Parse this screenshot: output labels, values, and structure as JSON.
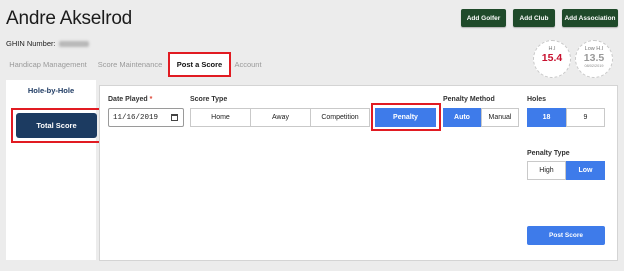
{
  "header": {
    "title": "Andre Akselrod",
    "ghin_label": "GHIN Number:",
    "buttons": {
      "add_golfer": "Add Golfer",
      "add_club": "Add Club",
      "add_association": "Add Association"
    }
  },
  "tabs": [
    {
      "label": "Handicap Management"
    },
    {
      "label": "Score Maintenance"
    },
    {
      "label": "Post a Score"
    },
    {
      "label": "Account"
    }
  ],
  "badges": {
    "hi": {
      "label": "H.I",
      "value": "15.4"
    },
    "low_hi": {
      "label": "Low H.I",
      "value": "13.5",
      "date": "08/02/2019"
    }
  },
  "sidebar": {
    "hole_by_hole": "Hole-by-Hole",
    "total_score": "Total Score"
  },
  "form": {
    "date_played": {
      "label": "Date Played",
      "required_mark": "*",
      "value": "11/16/2019"
    },
    "score_type": {
      "label": "Score Type",
      "options": [
        "Home",
        "Away",
        "Competition",
        "Penalty"
      ],
      "selected": "Penalty"
    },
    "penalty_method": {
      "label": "Penalty Method",
      "options": [
        "Auto",
        "Manual"
      ],
      "selected": "Auto"
    },
    "holes": {
      "label": "Holes",
      "options": [
        "18",
        "9"
      ],
      "selected": "18"
    },
    "penalty_type": {
      "label": "Penalty Type",
      "options": [
        "High",
        "Low"
      ],
      "selected": "Low"
    },
    "post_score": "Post Score"
  },
  "colors": {
    "accent_blue": "#3e7bea",
    "dark_green": "#1f4a2a",
    "navy": "#1c3b61",
    "highlight_red": "#e11b22",
    "hi_red": "#c8102e",
    "gray_text": "#9a9a9a"
  }
}
